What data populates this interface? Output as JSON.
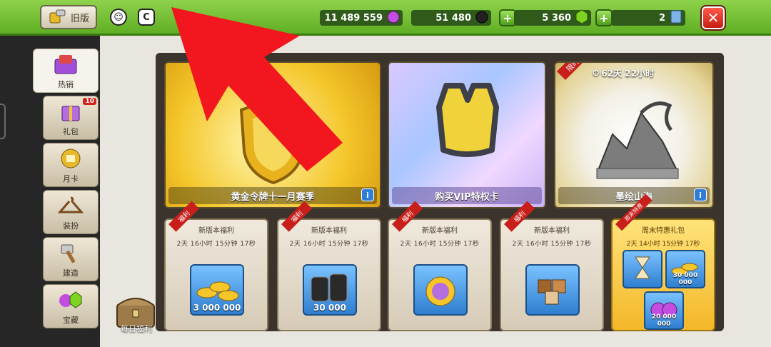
{
  "topbar": {
    "old_version_label": "旧版",
    "resources": [
      {
        "value": "11 489 559",
        "icon": "elixir-icon",
        "color": "#c24de0"
      },
      {
        "value": "51 480",
        "icon": "dark-elixir-icon",
        "color": "#222222"
      },
      {
        "value": "5 360",
        "icon": "gem-icon",
        "color": "#7ed321"
      },
      {
        "value": "2",
        "icon": "book-icon",
        "color": "#7fb2e6"
      }
    ],
    "close_icon": "close-icon"
  },
  "sidebar": {
    "items": [
      {
        "label": "热销",
        "icon": "hot-sale-icon",
        "active": true
      },
      {
        "label": "礼包",
        "icon": "gift-icon",
        "badge": "10"
      },
      {
        "label": "月卡",
        "icon": "monthly-card-icon"
      },
      {
        "label": "装扮",
        "icon": "hanger-icon"
      },
      {
        "label": "建造",
        "icon": "hammer-icon"
      },
      {
        "label": "宝藏",
        "icon": "gems-icon"
      }
    ]
  },
  "featured": [
    {
      "label": "黄金令牌十一月赛季"
    },
    {
      "label": "购买VIP特权卡"
    },
    {
      "label": "墨绘山海",
      "ribbon": "限时",
      "timer": "62天 22小时"
    }
  ],
  "offers": [
    {
      "ribbon": "福利",
      "title": "新版本福利",
      "time": "2天 16小时 15分钟 17秒",
      "value": "3 000 000",
      "icon": "gold-coins-icon"
    },
    {
      "ribbon": "福利",
      "title": "新版本福利",
      "time": "2天 16小时 15分钟 17秒",
      "value": "30 000",
      "icon": "dark-elixir-bottles-icon"
    },
    {
      "ribbon": "福利",
      "title": "新版本福利",
      "time": "2天 16小时 15分钟 17秒",
      "value": "",
      "icon": "potion-icon"
    },
    {
      "ribbon": "福利",
      "title": "新版本福利",
      "time": "2天 16小时 15分钟 17秒",
      "value": "",
      "icon": "blocks-icon"
    }
  ],
  "weekend_offer": {
    "ribbon": "周末特惠",
    "title": "周末特惠礼包",
    "time": "2天 14小时 15分钟 17秒",
    "items": [
      {
        "value": "",
        "icon": "hourglass-icon"
      },
      {
        "value": "30 000 000",
        "icon": "gold-coins-icon"
      },
      {
        "value": "20 000 000",
        "icon": "elixir-icon"
      }
    ]
  },
  "daily_reward": {
    "label": "每日福利"
  }
}
